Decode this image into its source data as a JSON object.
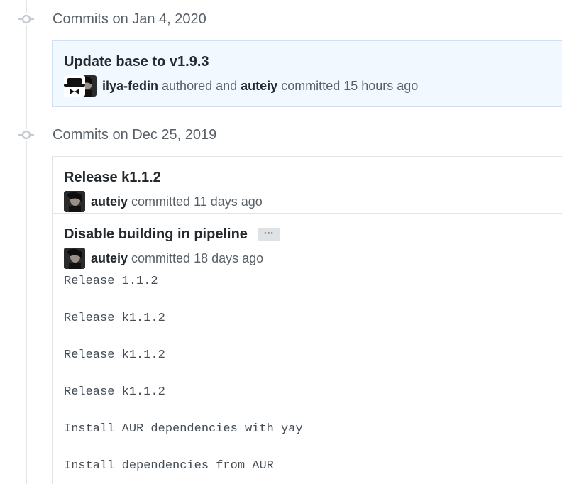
{
  "groups": [
    {
      "title": "Commits on Jan 4, 2020",
      "commits": [
        {
          "title": "Update base to v1.9.3",
          "author": "ilya-fedin",
          "authored_text": "authored and",
          "committer": "auteiy",
          "committed_text": "committed 15 hours ago"
        }
      ]
    },
    {
      "title": "Commits on Dec 25, 2019",
      "commits": [
        {
          "title": "Release k1.1.2",
          "committer": "auteiy",
          "committed_text": "committed 11 days ago"
        },
        {
          "title": "Disable building in pipeline",
          "ellipsis_label": "···",
          "committer": "auteiy",
          "committed_text": "committed 18 days ago",
          "body_lines": [
            "Release 1.1.2",
            "Release k1.1.2",
            "Release k1.1.2",
            "Release k1.1.2",
            "Install AUR dependencies with yay",
            "Install dependencies from AUR"
          ]
        }
      ]
    }
  ],
  "colors": {
    "timeline": "#e1e4e8",
    "highlight_bg": "#f1f8ff",
    "highlight_border": "#c8e1ff",
    "muted_text": "#586069"
  },
  "icons": {
    "commit_node": "git-commit-icon",
    "author_avatar": "spy-hat-avatar",
    "committer_avatar": "dark-portrait-avatar"
  }
}
